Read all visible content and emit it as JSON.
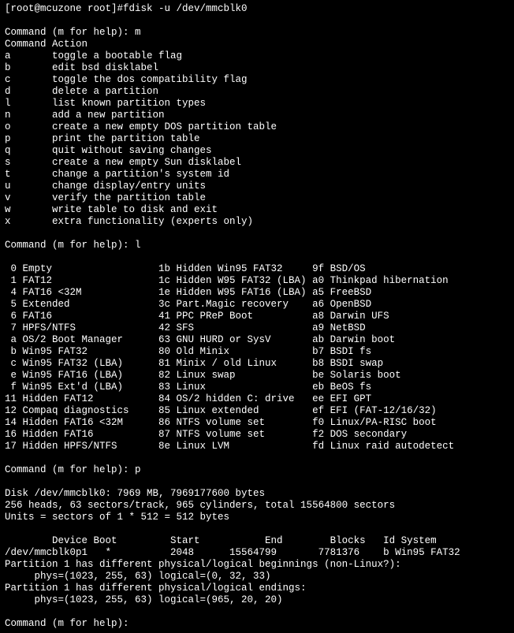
{
  "prompt_line": "[root@mcuzone root]#fdisk -u /dev/mmcblk0",
  "blank1": "",
  "cmd_help1": "Command (m for help): m",
  "cmd_action_header": "Command Action",
  "actions": [
    "a       toggle a bootable flag",
    "b       edit bsd disklabel",
    "c       toggle the dos compatibility flag",
    "d       delete a partition",
    "l       list known partition types",
    "n       add a new partition",
    "o       create a new empty DOS partition table",
    "p       print the partition table",
    "q       quit without saving changes",
    "s       create a new empty Sun disklabel",
    "t       change a partition's system id",
    "u       change display/entry units",
    "v       verify the partition table",
    "w       write table to disk and exit",
    "x       extra functionality (experts only)"
  ],
  "blank2": "",
  "cmd_help2": "Command (m for help): l",
  "blank3": "",
  "types": [
    " 0 Empty                  1b Hidden Win95 FAT32     9f BSD/OS",
    " 1 FAT12                  1c Hidden W95 FAT32 (LBA) a0 Thinkpad hibernation",
    " 4 FAT16 <32M             1e Hidden W95 FAT16 (LBA) a5 FreeBSD",
    " 5 Extended               3c Part.Magic recovery    a6 OpenBSD",
    " 6 FAT16                  41 PPC PReP Boot          a8 Darwin UFS",
    " 7 HPFS/NTFS              42 SFS                    a9 NetBSD",
    " a OS/2 Boot Manager      63 GNU HURD or SysV       ab Darwin boot",
    " b Win95 FAT32            80 Old Minix              b7 BSDI fs",
    " c Win95 FAT32 (LBA)      81 Minix / old Linux      b8 BSDI swap",
    " e Win95 FAT16 (LBA)      82 Linux swap             be Solaris boot",
    " f Win95 Ext'd (LBA)      83 Linux                  eb BeOS fs",
    "11 Hidden FAT12           84 OS/2 hidden C: drive   ee EFI GPT",
    "12 Compaq diagnostics     85 Linux extended         ef EFI (FAT-12/16/32)",
    "14 Hidden FAT16 <32M      86 NTFS volume set        f0 Linux/PA-RISC boot",
    "16 Hidden FAT16           87 NTFS volume set        f2 DOS secondary",
    "17 Hidden HPFS/NTFS       8e Linux LVM              fd Linux raid autodetect"
  ],
  "blank4": "",
  "cmd_help3": "Command (m for help): p",
  "blank5": "",
  "disk_line1": "Disk /dev/mmcblk0: 7969 MB, 7969177600 bytes",
  "disk_line2": "256 heads, 63 sectors/track, 965 cylinders, total 15564800 sectors",
  "disk_line3": "Units = sectors of 1 * 512 = 512 bytes",
  "blank6": "",
  "ptable_header": "        Device Boot         Start           End        Blocks   Id System",
  "ptable_row": "/dev/mmcblk0p1   *          2048      15564799       7781376    b Win95 FAT32",
  "warn1": "Partition 1 has different physical/logical beginnings (non-Linux?):",
  "warn2": "     phys=(1023, 255, 63) logical=(0, 32, 33)",
  "warn3": "Partition 1 has different physical/logical endings:",
  "warn4": "     phys=(1023, 255, 63) logical=(965, 20, 20)",
  "blank7": "",
  "cmd_help4": "Command (m for help):",
  "chart_data": {
    "type": "table",
    "title": "Partition table for /dev/mmcblk0",
    "columns": [
      "Device",
      "Boot",
      "Start",
      "End",
      "Blocks",
      "Id",
      "System"
    ],
    "rows": [
      [
        "/dev/mmcblk0p1",
        "*",
        2048,
        15564799,
        7781376,
        "b",
        "Win95 FAT32"
      ]
    ],
    "disk": {
      "device": "/dev/mmcblk0",
      "size_mb": 7969,
      "size_bytes": 7969177600,
      "heads": 256,
      "sectors_per_track": 63,
      "cylinders": 965,
      "total_sectors": 15564800,
      "unit_bytes": 512
    }
  }
}
